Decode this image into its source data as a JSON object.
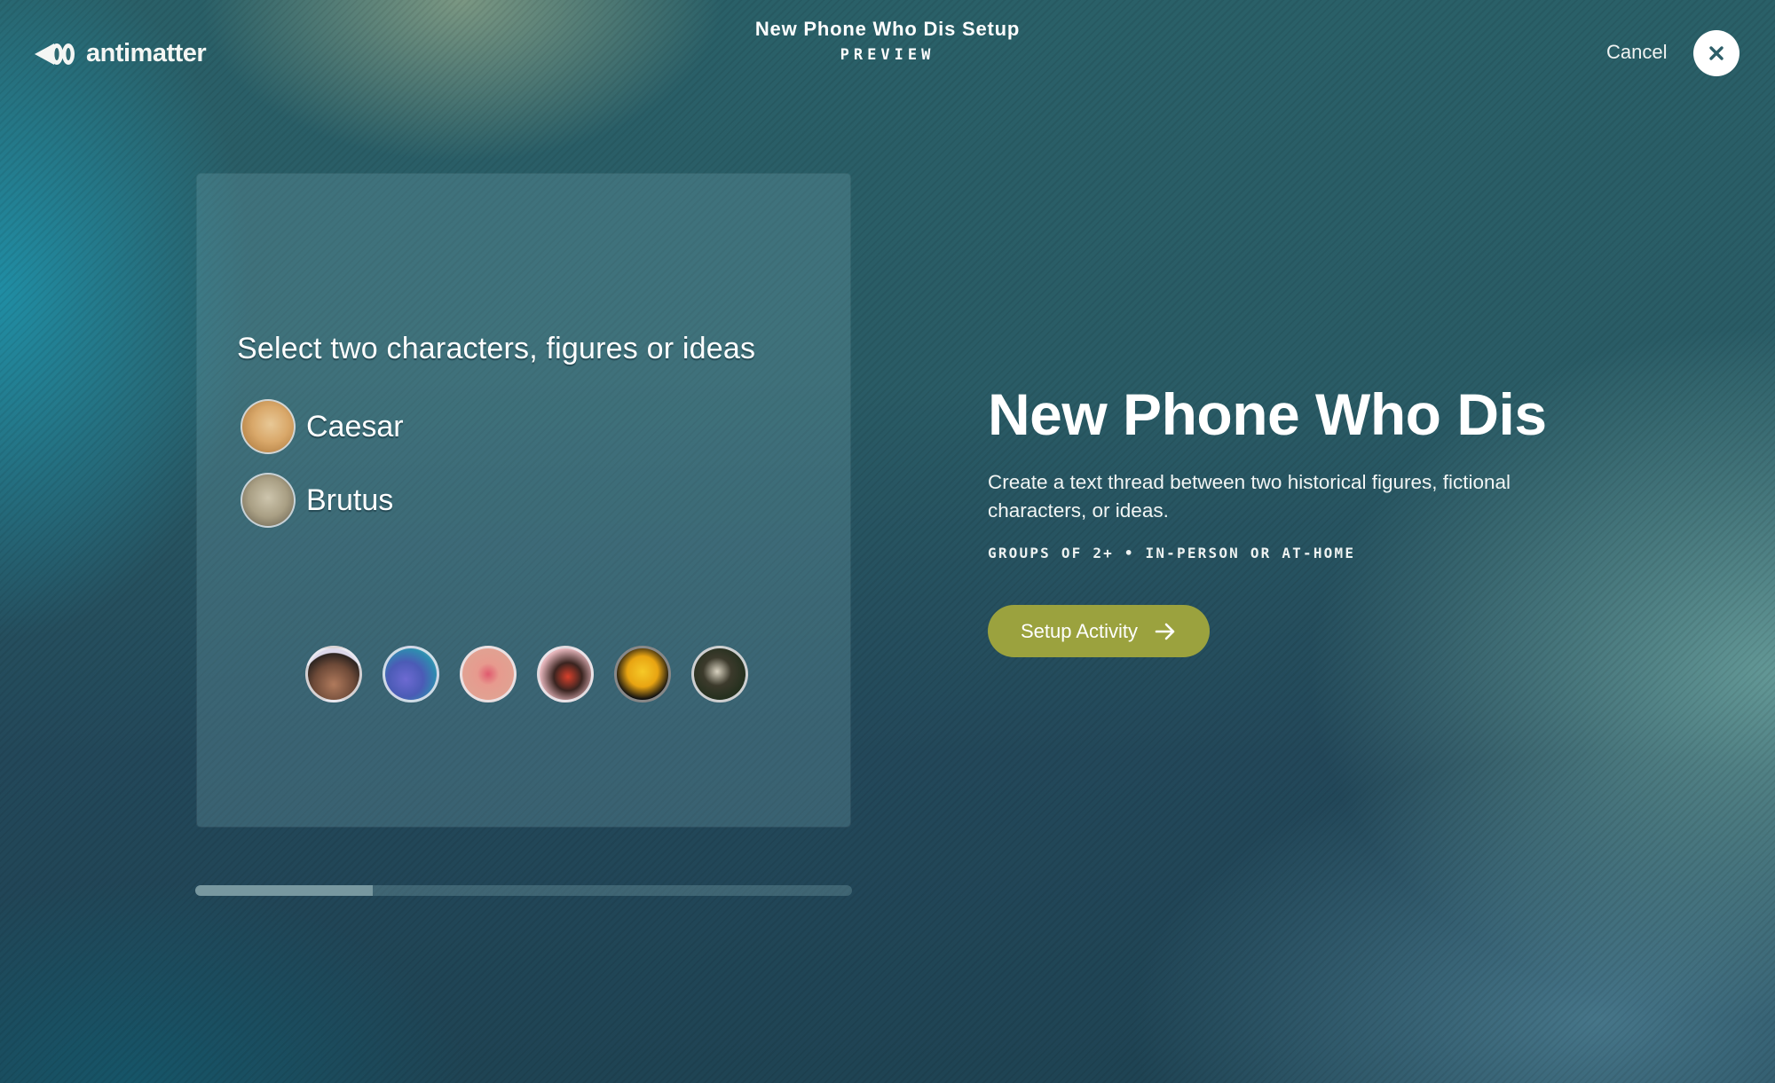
{
  "brand": {
    "name": "antimatter",
    "icon": "antimatter-logo-icon"
  },
  "header": {
    "title": "New Phone Who Dis Setup",
    "subtitle": "PREVIEW",
    "cancel_label": "Cancel",
    "close_icon": "close-icon"
  },
  "preview": {
    "prompt": "Select two characters, figures or ideas",
    "selected": [
      {
        "name": "Caesar",
        "avatar": "caesar-portrait"
      },
      {
        "name": "Brutus",
        "avatar": "brutus-bust"
      }
    ],
    "options": [
      {
        "avatar": "man-face-closeup"
      },
      {
        "avatar": "underwater-coral"
      },
      {
        "avatar": "pink-food-dish"
      },
      {
        "avatar": "woman-eating"
      },
      {
        "avatar": "yellow-duck-with-knife"
      },
      {
        "avatar": "woman-painting-portrait"
      }
    ],
    "progress_percent": 27
  },
  "activity": {
    "title": "New Phone Who Dis",
    "description": "Create a text thread between two historical figures, fictional characters, or ideas.",
    "meta": "GROUPS OF 2+ • IN-PERSON OR AT-HOME",
    "cta_label": "Setup Activity",
    "cta_icon": "arrow-right-icon",
    "cta_color": "#9ba23e"
  }
}
